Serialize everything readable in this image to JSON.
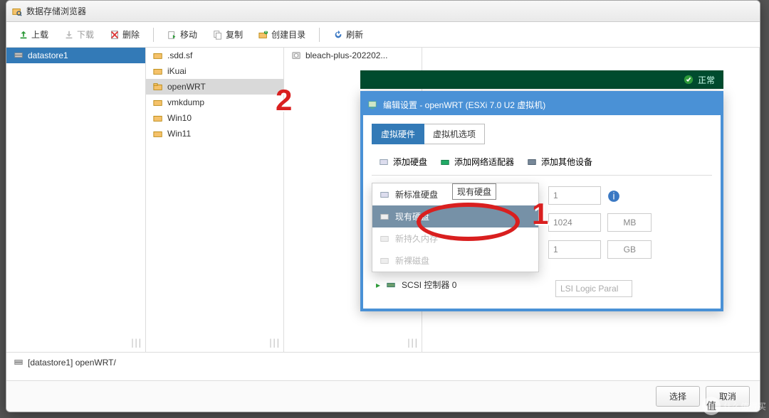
{
  "window": {
    "title": "数据存储浏览器"
  },
  "toolbar": {
    "upload": "上载",
    "download": "下载",
    "delete": "删除",
    "move": "移动",
    "copy": "复制",
    "mkdir": "创建目录",
    "refresh": "刷新"
  },
  "cols": {
    "c1": [
      {
        "label": "datastore1",
        "selected": true
      }
    ],
    "c2": [
      {
        "label": ".sdd.sf"
      },
      {
        "label": "iKuai"
      },
      {
        "label": "openWRT",
        "selected": true
      },
      {
        "label": "vmkdump"
      },
      {
        "label": "Win10"
      },
      {
        "label": "Win11"
      }
    ],
    "c3": [
      {
        "label": "bleach-plus-202202..."
      }
    ]
  },
  "path": "[datastore1] openWRT/",
  "footer": {
    "select": "选择",
    "cancel": "取消"
  },
  "status_ok": "正常",
  "popup": {
    "title": "编辑设置 - openWRT (ESXi 7.0 U2 虚拟机)",
    "tabs": {
      "hw": "虚拟硬件",
      "opts": "虚拟机选项"
    },
    "add_hdd": "添加硬盘",
    "add_nic": "添加网络适配器",
    "add_other": "添加其他设备",
    "drop": {
      "new": "新标准硬盘",
      "existing": "现有硬盘",
      "existing_tip": "现有硬盘",
      "thin": "新持久内存",
      "raw": "新裸磁盘"
    },
    "fields": {
      "cpu": "1",
      "mem": "1024",
      "mem_unit": "MB",
      "disk": "1",
      "disk_unit": "GB"
    },
    "scsi": "SCSI 控制器 0",
    "lsi": "LSI Logic Paral"
  },
  "annotations": {
    "one": "1",
    "two": "2"
  },
  "watermark": "什么值得买"
}
